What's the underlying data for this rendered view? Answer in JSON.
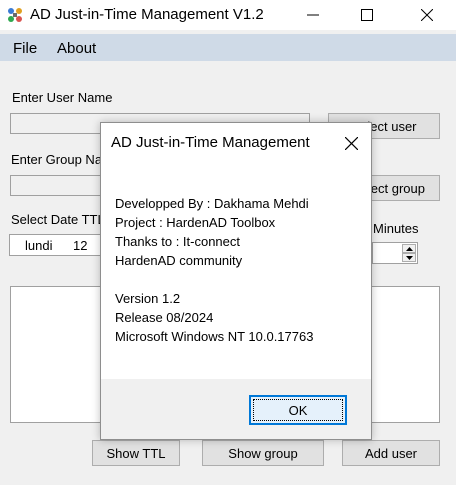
{
  "window": {
    "title": "AD Just-in-Time Management V1.2",
    "minimize": "minimize",
    "maximize": "maximize",
    "close": "close"
  },
  "menu": {
    "file": "File",
    "about": "About"
  },
  "form": {
    "user_label": "Enter User Name",
    "group_label": "Enter Group Na",
    "ttl_label": "Select Date TTL",
    "minutes_label": "Minutes",
    "date_day": "lundi",
    "date_num": "12",
    "select_user": "Select user",
    "select_group": "ect group",
    "show_ttl": "Show TTL",
    "show_group": "Show group",
    "add_user": "Add user"
  },
  "dialog": {
    "title": "AD Just-in-Time Management",
    "lines": [
      "Developped By : Dakhama Mehdi",
      "Project : HardenAD Toolbox",
      "Thanks to : It-connect",
      "HardenAD community",
      "Version 1.2",
      "Release   08/2024",
      "Microsoft Windows NT 10.0.17763"
    ],
    "ok": "OK"
  },
  "colors": {
    "menubar": "#cfdae7",
    "accent": "#0078d7"
  }
}
